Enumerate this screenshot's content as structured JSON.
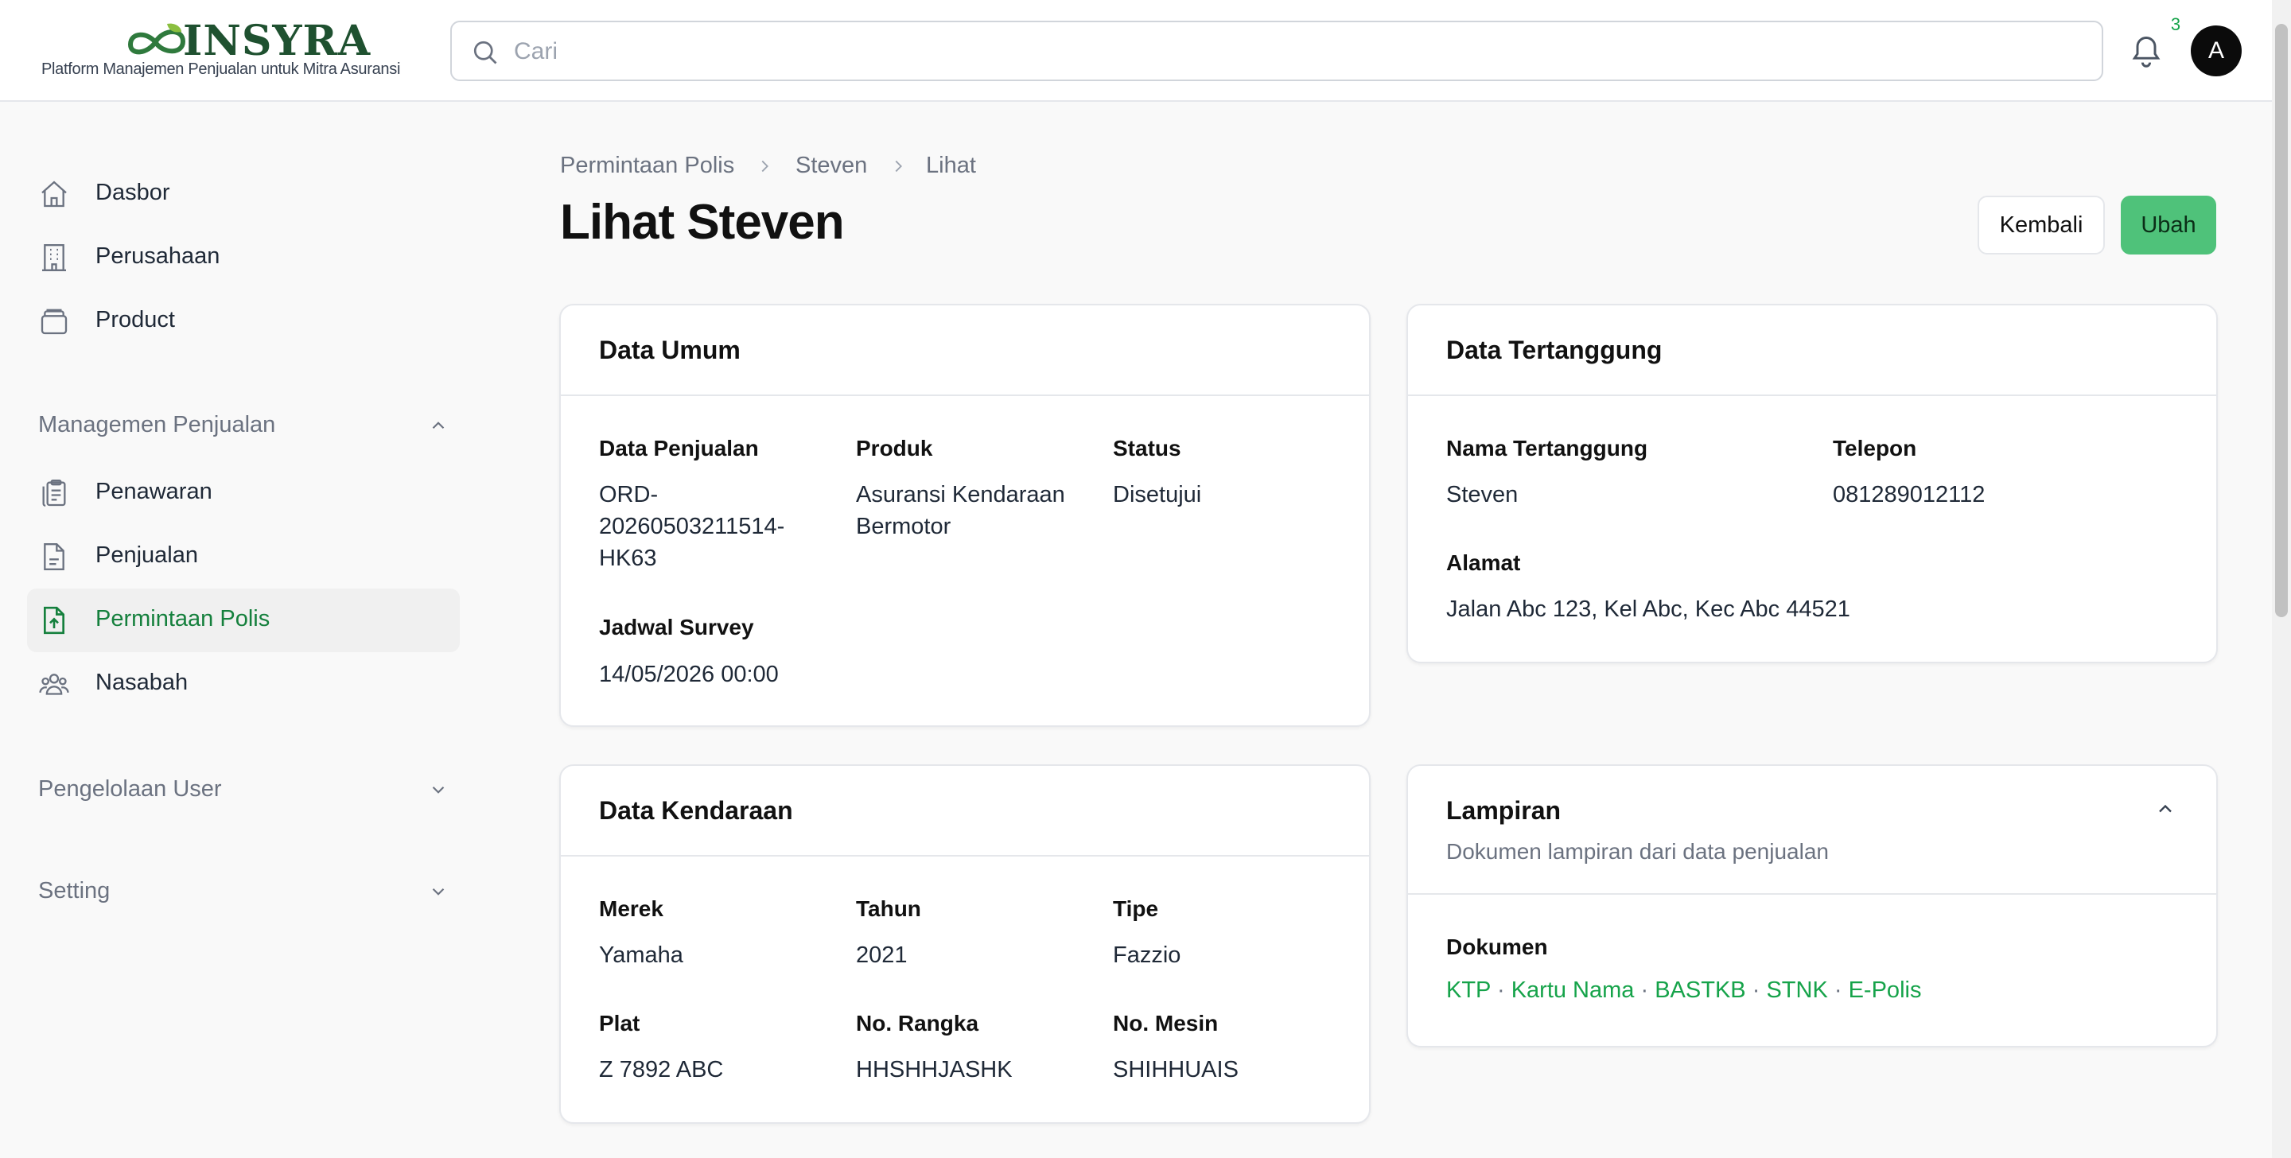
{
  "brand": {
    "name": "INSYRA",
    "tagline": "Platform Manajemen Penjualan untuk Mitra Asuransi",
    "color": "#1f5130",
    "accent_color": "#4fc27a"
  },
  "header": {
    "search_placeholder": "Cari",
    "notification_count": "3",
    "avatar_initial": "A"
  },
  "sidebar": {
    "top_items": [
      {
        "label": "Dasbor",
        "icon": "home-icon"
      },
      {
        "label": "Perusahaan",
        "icon": "building-icon"
      },
      {
        "label": "Product",
        "icon": "archive-icon"
      }
    ],
    "group_sales": {
      "label": "Managemen Penjualan",
      "expanded": true,
      "items": [
        {
          "label": "Penawaran",
          "icon": "clipboard-icon"
        },
        {
          "label": "Penjualan",
          "icon": "document-icon"
        },
        {
          "label": "Permintaan Polis",
          "icon": "document-upload-icon",
          "active": true
        },
        {
          "label": "Nasabah",
          "icon": "users-icon"
        }
      ]
    },
    "group_user": {
      "label": "Pengelolaan User",
      "expanded": false
    },
    "group_setting": {
      "label": "Setting",
      "expanded": false
    }
  },
  "breadcrumb": [
    "Permintaan Polis",
    "Steven",
    "Lihat"
  ],
  "page": {
    "title": "Lihat Steven",
    "back_label": "Kembali",
    "edit_label": "Ubah"
  },
  "data_umum": {
    "title": "Data Umum",
    "fields": {
      "penjualan_label": "Data Penjualan",
      "penjualan_value_lines": [
        "ORD-",
        "20260503211514-",
        "HK63"
      ],
      "produk_label": "Produk",
      "produk_value_lines": [
        "Asuransi Kendaraan",
        "Bermotor"
      ],
      "status_label": "Status",
      "status_value": "Disetujui",
      "jadwal_label": "Jadwal Survey",
      "jadwal_value": "14/05/2026 00:00"
    }
  },
  "data_tertanggung": {
    "title": "Data Tertanggung",
    "fields": {
      "nama_label": "Nama Tertanggung",
      "nama_value": "Steven",
      "telepon_label": "Telepon",
      "telepon_value": "081289012112",
      "alamat_label": "Alamat",
      "alamat_value": "Jalan Abc 123, Kel Abc, Kec Abc 44521"
    }
  },
  "data_kendaraan": {
    "title": "Data Kendaraan",
    "fields": {
      "merek_label": "Merek",
      "merek_value": "Yamaha",
      "tahun_label": "Tahun",
      "tahun_value": "2021",
      "tipe_label": "Tipe",
      "tipe_value": "Fazzio",
      "plat_label": "Plat",
      "plat_value": "Z 7892 ABC",
      "rangka_label": "No. Rangka",
      "rangka_value": "HHSHHJASHK",
      "mesin_label": "No. Mesin",
      "mesin_value": "SHIHHUAIS"
    }
  },
  "lampiran": {
    "title": "Lampiran",
    "subtitle": "Dokumen lampiran dari data penjualan",
    "expanded": true,
    "dokumen_label": "Dokumen",
    "separator": "·",
    "documents": [
      "KTP",
      "Kartu Nama",
      "BASTKB",
      "STNK",
      "E-Polis"
    ]
  }
}
